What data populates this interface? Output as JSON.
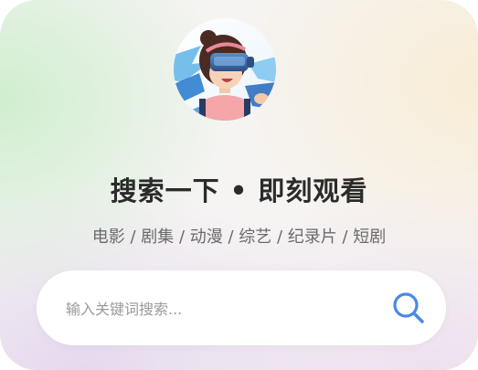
{
  "hero": {
    "avatar_icon": "vr-headset-girl-illustration"
  },
  "title": "搜索一下 • 即刻观看",
  "categories": "电影 / 剧集 / 动漫 / 综艺 / 纪录片 / 短剧",
  "search": {
    "placeholder": "输入关键词搜索...",
    "value": "",
    "icon": "search-icon"
  },
  "colors": {
    "accent": "#4a8ae8",
    "title": "#2b2b2b",
    "subtitle": "#6a6a6a",
    "placeholder": "#9a9a9a"
  }
}
